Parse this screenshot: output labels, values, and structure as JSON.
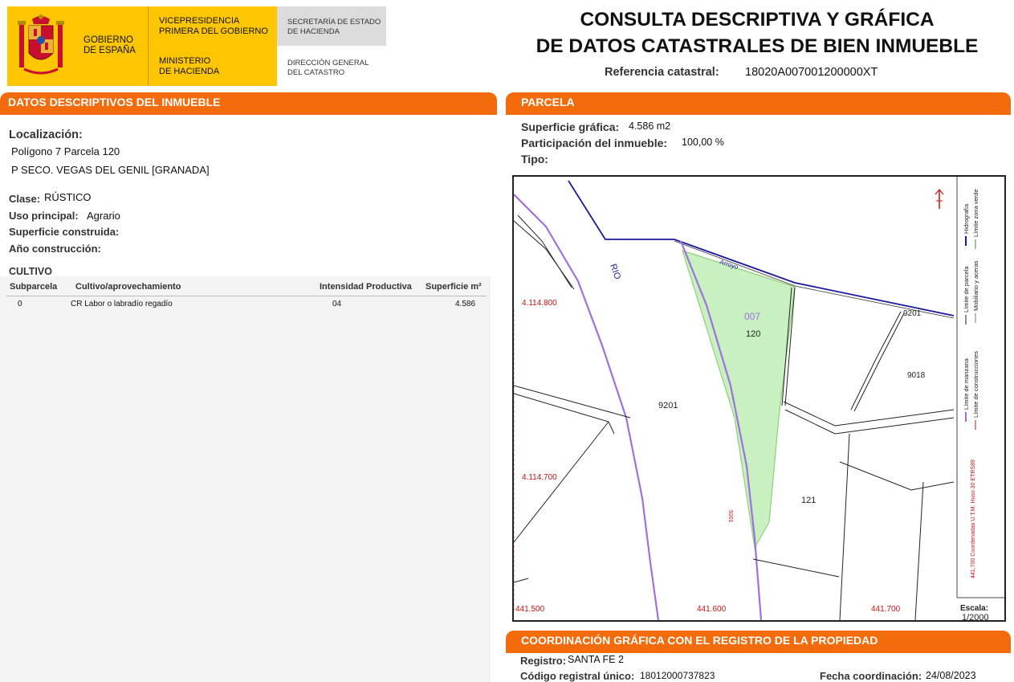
{
  "header": {
    "gobierno": [
      "GOBIERNO",
      "DE ESPAÑA"
    ],
    "vicepresidencia": [
      "VICEPRESIDENCIA",
      "PRIMERA DEL GOBIERNO"
    ],
    "ministerio": [
      "MINISTERIO",
      "DE HACIENDA"
    ],
    "secretaria": [
      "SECRETARÍA DE ESTADO",
      "DE HACIENDA"
    ],
    "direccion": [
      "DIRECCIÓN GENERAL",
      "DEL CATASTRO"
    ],
    "title_line1": "CONSULTA DESCRIPTIVA Y GRÁFICA",
    "title_line2": "DE DATOS CATASTRALES DE BIEN INMUEBLE",
    "ref_label": "Referencia catastral:",
    "ref_value": "18020A007001200000XT"
  },
  "left": {
    "section_title": "DATOS DESCRIPTIVOS DEL INMUEBLE",
    "localizacion_label": "Localización:",
    "localizacion_line1": "Polígono 7 Parcela 120",
    "localizacion_line2": "P SECO. VEGAS DEL GENIL [GRANADA]",
    "clase_label": "Clase:",
    "clase_value": "RÚSTICO",
    "uso_label": "Uso principal:",
    "uso_value": "Agrario",
    "superficie_construida_label": "Superficie construida:",
    "ano_label": "Año construcción:",
    "cultivo": {
      "title": "CULTIVO",
      "headers": [
        "Subparcela",
        "Cultivo/aprovechamiento",
        "Intensidad Productiva",
        "Superficie m²"
      ],
      "rows": [
        {
          "subparcela": "0",
          "cultivo": "CR Labor o labradío regadío",
          "intensidad": "04",
          "superficie": "4.586"
        }
      ]
    }
  },
  "right": {
    "section_title": "PARCELA",
    "superficie_label": "Superficie gráfica:",
    "superficie_value": "4.586 m2",
    "participacion_label": "Participación del inmueble:",
    "participacion_value": "100,00 %",
    "tipo_label": "Tipo:",
    "map": {
      "coords": {
        "y_top": "4.114.800",
        "y_bottom": "4.114.700",
        "x_left": "441.500",
        "x_mid": "441.600",
        "x_right": "441.700"
      },
      "labels": {
        "rio": "RIO",
        "arroyo": "Arroyo",
        "poligono": "007",
        "parcela": "120",
        "p9201": "9201",
        "p121": "121",
        "p9201b": "9201",
        "p9018": "9018",
        "p9201c": "9201"
      },
      "legend": {
        "limite_manzana": "Límite de manzana",
        "limite_parcela": "Límite de parcela",
        "hidrografia": "Hidrografía",
        "limite_construcciones": "Límite de construcciones",
        "mobiliario": "Mobiliario y aceras",
        "zona_verde": "Límite zona verde",
        "utm": "441,700 Coordenadas U.T.M. Huso 30 ETRS89"
      },
      "escala_label": "Escala:",
      "escala_value": "1/2000",
      "colors": {
        "parcel_fill": "#c8f0c0",
        "parcel_border": "#8fcf7a",
        "river_line": "#1a1aa0",
        "manzana_line": "#a070e0",
        "coord_text": "#cc1111"
      }
    }
  },
  "coordinacion": {
    "section_title": "COORDINACIÓN GRÁFICA CON EL REGISTRO DE LA PROPIEDAD",
    "registro_label": "Registro:",
    "registro_value": "SANTA FE 2",
    "codigo_label": "Código registral único:",
    "codigo_value": "18012000737823",
    "fecha_label": "Fecha coordinación:",
    "fecha_value": "24/08/2023"
  },
  "colors": {
    "accent": "#f26b0d",
    "gov_yellow": "#fdc600"
  }
}
